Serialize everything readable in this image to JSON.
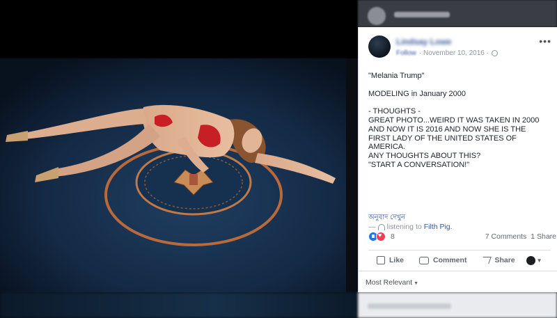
{
  "post": {
    "author": "Lindsay Lowe",
    "follow": "Follow",
    "date": "· November 10, 2016 ·",
    "text_lines": [
      "\"Melania Trump\"",
      "",
      "MODELING in January 2000",
      "",
      "- THOUGHTS -",
      "GREAT PHOTO...WEIRD IT WAS TAKEN IN 2000",
      "AND NOW IT IS 2016 AND NOW SHE IS THE",
      "FIRST LADY OF THE UNITED STATES OF",
      "AMERICA.",
      "ANY THOUGHTS ABOUT THIS?",
      "\"START A CONVERSATION!\""
    ],
    "translate_label": "অনুবাদ দেখুন",
    "listening_prefix": "—",
    "listening_text": "listening to",
    "listening_link": "Filth Pig."
  },
  "stats": {
    "reaction_count": "8",
    "comments": "7 Comments",
    "shares": "1 Share"
  },
  "actions": {
    "like": "Like",
    "comment": "Comment",
    "share": "Share"
  },
  "sort_label": "Most Relevant",
  "colors": {
    "link": "#365899",
    "like_blue": "#1877f2",
    "love_red": "#f33e58",
    "seal_ring": "#b86a3c"
  },
  "icons": [
    "globe-icon",
    "more-options-icon",
    "headphones-icon",
    "like-reaction-icon",
    "love-reaction-icon",
    "thumb-icon",
    "comment-icon",
    "share-icon",
    "caret-down-icon"
  ]
}
